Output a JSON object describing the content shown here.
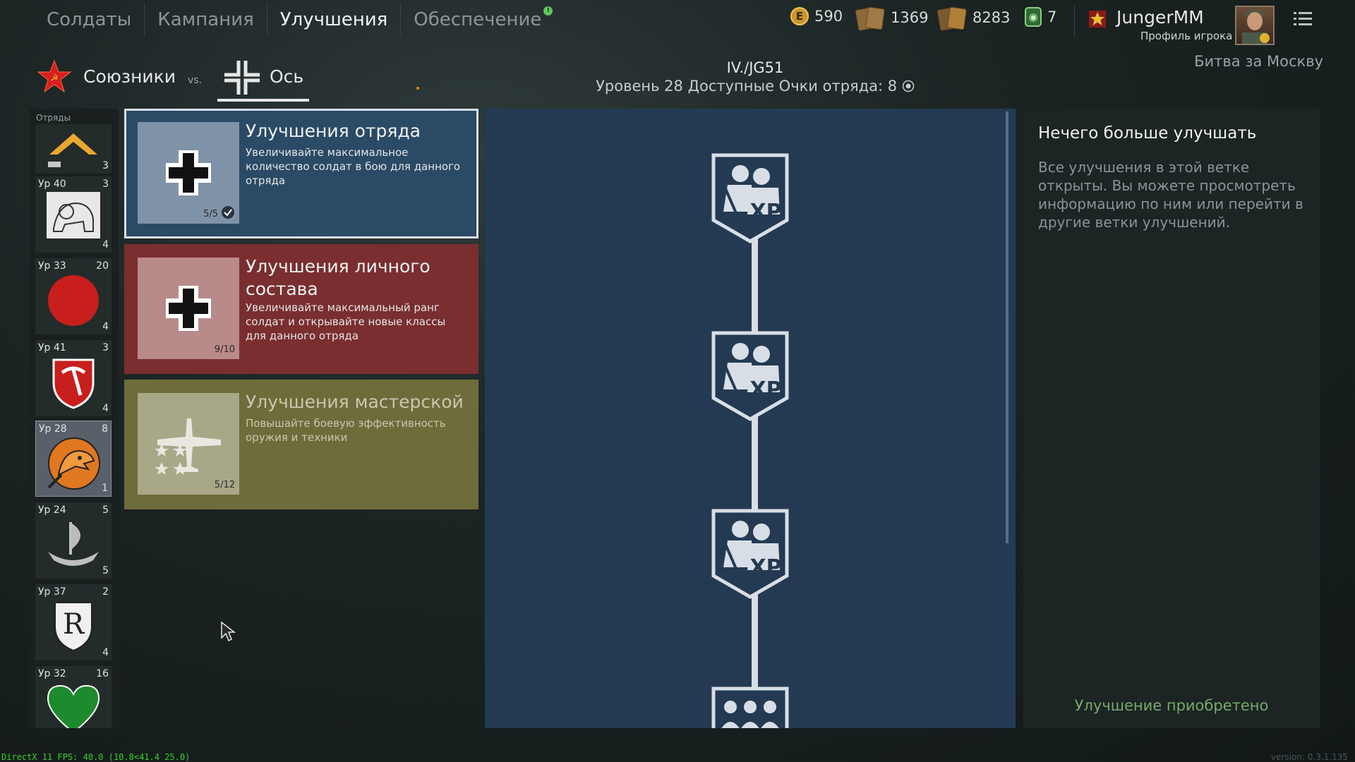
{
  "nav": {
    "items": [
      "Солдаты",
      "Кампания",
      "Улучшения",
      "Обеспечение"
    ],
    "active_index": 2,
    "supply_badge": "!"
  },
  "currency": {
    "gold_symbol": "E",
    "gold": "590",
    "orders_1": "1369",
    "orders_2": "8283",
    "tickets": "7"
  },
  "profile": {
    "username": "JungerMM",
    "label": "Профиль игрока"
  },
  "battle": "Битва за Москву",
  "factions": {
    "allies": "Союзники",
    "vs": "vs.",
    "axis": "Ось",
    "selected": "axis"
  },
  "unit": {
    "name": "IV./JG51",
    "level_text": "Уровень 28 Доступные Очки отряда: 8"
  },
  "squads": {
    "title": "Отряды",
    "items": [
      {
        "level": "",
        "points": "",
        "count": "3",
        "emblem": "chevron-emblem"
      },
      {
        "level": "Ур 40",
        "points": "3",
        "count": "4",
        "emblem": "lion-emblem"
      },
      {
        "level": "Ур 33",
        "points": "20",
        "count": "4",
        "emblem": "red-circle-emblem"
      },
      {
        "level": "Ур 41",
        "points": "3",
        "count": "4",
        "emblem": "pickaxe-shield-emblem"
      },
      {
        "level": "Ур 28",
        "points": "8",
        "count": "1",
        "emblem": "eagle-emblem"
      },
      {
        "level": "Ур 24",
        "points": "5",
        "count": "5",
        "emblem": "viking-ship-emblem"
      },
      {
        "level": "Ур 37",
        "points": "2",
        "count": "4",
        "emblem": "r-shield-emblem"
      },
      {
        "level": "Ур 32",
        "points": "16",
        "count": "",
        "emblem": "green-heart-emblem"
      }
    ]
  },
  "upgrades": [
    {
      "title": "Улучшения отряда",
      "desc": "Увеличивайте максимальное количество солдат в бою для данного отряда",
      "progress": "5/5",
      "color": "#2b4a66"
    },
    {
      "title": "Улучшения личного состава",
      "desc": "Увеличивайте максимальный ранг солдат и открывайте новые классы для данного отряда",
      "progress": "9/10",
      "color": "#7a2e30"
    },
    {
      "title": "Улучшения мастерской",
      "desc": "Повышайте боевую эффективность оружия и техники",
      "progress": "5/12",
      "color": "#6e6c3a"
    }
  ],
  "tree": {
    "nodes": [
      {
        "icon": "soldiers-xp-icon",
        "label": "XP"
      },
      {
        "icon": "soldiers-xp-icon",
        "label": "XP"
      },
      {
        "icon": "soldiers-xp-icon",
        "label": "XP"
      },
      {
        "icon": "squad-size-icon",
        "label": ""
      }
    ]
  },
  "info": {
    "title": "Нечего больше улучшать",
    "desc": "Все улучшения в этой ветке открыты. Вы можете просмотреть информацию по ним или перейти в другие ветки улучшений.",
    "status": "Улучшение приобретено"
  },
  "debug": {
    "fps": "DirectX 11 FPS: 40.0 (10.8<41.4 25.0)",
    "version": "version: 0.3.1.135"
  }
}
